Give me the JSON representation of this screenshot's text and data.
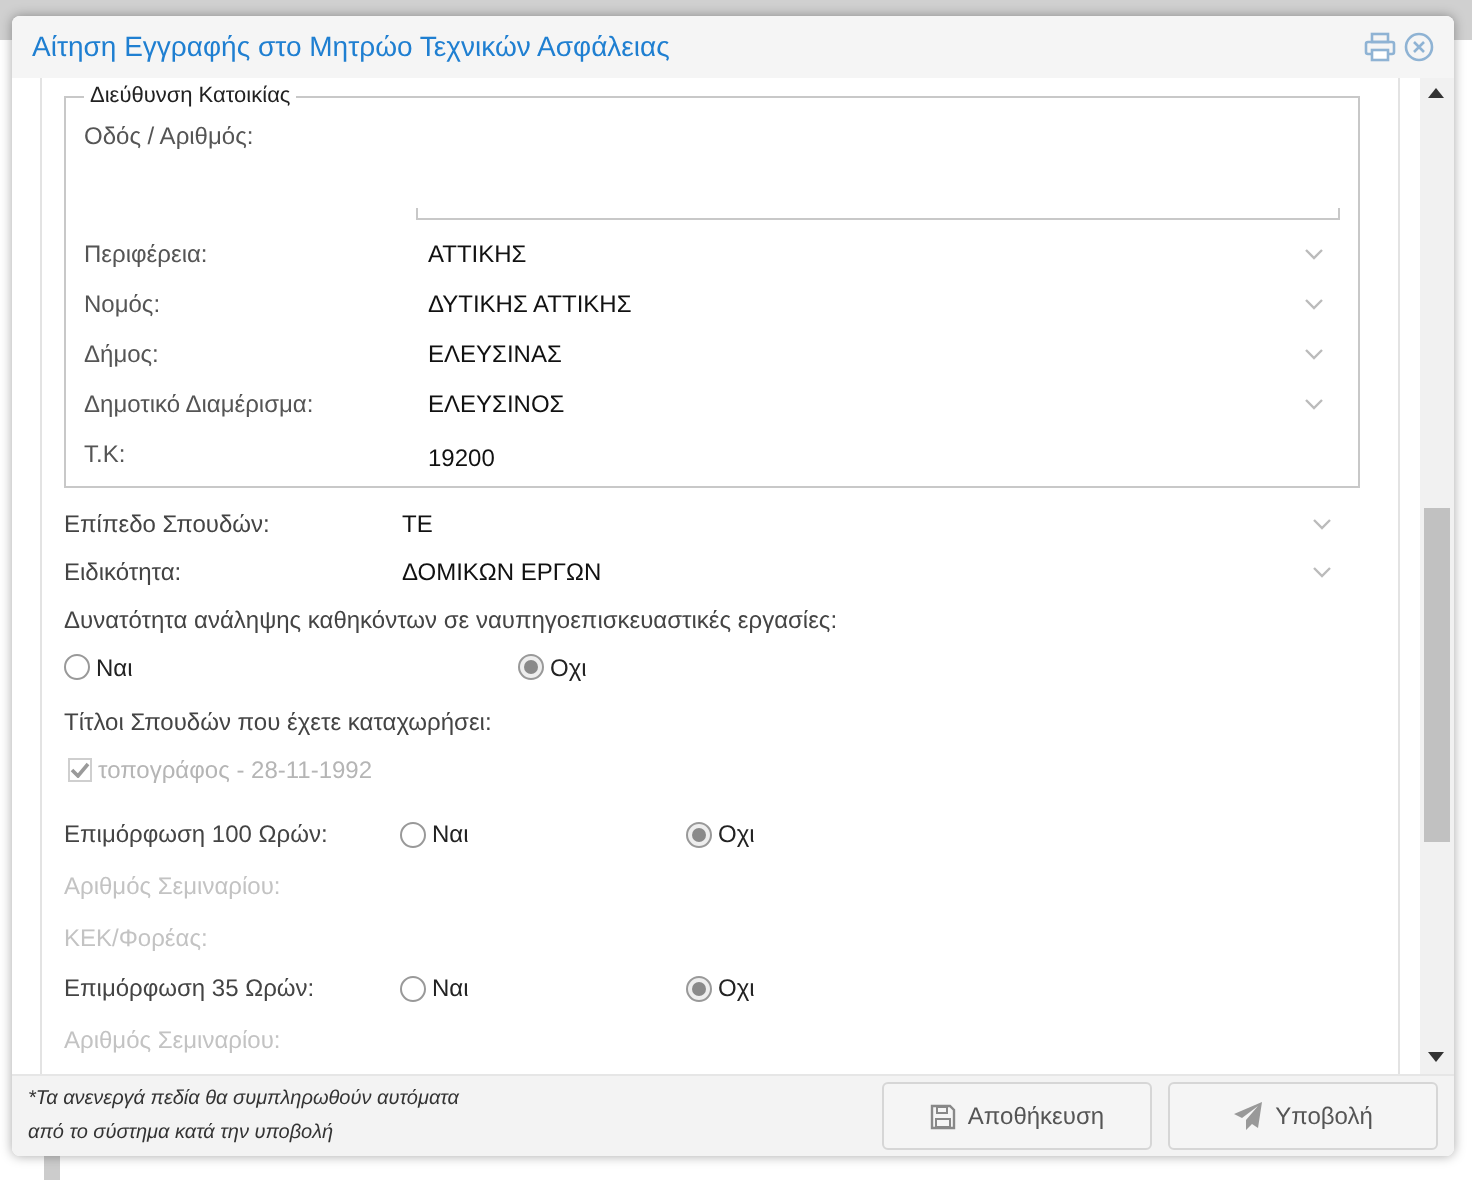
{
  "dialog": {
    "title": "Αίτηση Εγγραφής στο Μητρώο Τεχνικών Ασφάλειας"
  },
  "address": {
    "legend": "Διεύθυνση Κατοικίας",
    "street_label": "Οδός / Αριθμός:",
    "fields": [
      {
        "kind": "select",
        "label": "Περιφέρεια:",
        "value": "ΑΤΤΙΚΗΣ"
      },
      {
        "kind": "select",
        "label": "Νομός:",
        "value": "ΔΥΤΙΚΗΣ ΑΤΤΙΚΗΣ"
      },
      {
        "kind": "select",
        "label": "Δήμος:",
        "value": "ΕΛΕΥΣΙΝΑΣ"
      },
      {
        "kind": "select",
        "label": "Δημοτικό Διαμέρισμα:",
        "value": "ΕΛΕΥΣΙΝΟΣ"
      },
      {
        "kind": "text",
        "label": "Τ.Κ:",
        "value": "19200"
      }
    ]
  },
  "rows": [
    {
      "kind": "select",
      "label": "Επίπεδο Σπουδών:",
      "value": "ΤΕ"
    },
    {
      "kind": "select",
      "label": "Ειδικότητα:",
      "value": "ΔΟΜΙΚΩΝ ΕΡΓΩΝ"
    },
    {
      "kind": "question",
      "label": "Δυνατότητα ανάληψης καθηκόντων σε ναυπηγοεπισκευαστικές εργασίες:"
    },
    {
      "kind": "radios",
      "options": [
        {
          "label": "Ναι",
          "selected": false
        },
        {
          "label": "Οχι",
          "selected": true
        }
      ]
    },
    {
      "kind": "question",
      "label": "Τίτλοι Σπουδών που έχετε καταχωρήσει:"
    },
    {
      "kind": "checkbox",
      "label": "τοπογράφος - 28-11-1992",
      "checked": true,
      "disabled": true
    },
    {
      "kind": "labeled-radios",
      "label": "Επιμόρφωση 100 Ωρών:",
      "options": [
        {
          "label": "Ναι",
          "selected": false
        },
        {
          "label": "Οχι",
          "selected": true
        }
      ]
    },
    {
      "kind": "disabled",
      "label": "Αριθμός Σεμιναρίου:"
    },
    {
      "kind": "disabled",
      "label": "ΚΕΚ/Φορέας:"
    },
    {
      "kind": "labeled-radios",
      "label": "Επιμόρφωση 35 Ωρών:",
      "options": [
        {
          "label": "Ναι",
          "selected": false
        },
        {
          "label": "Οχι",
          "selected": true
        }
      ]
    },
    {
      "kind": "disabled",
      "label": "Αριθμός Σεμιναρίου:"
    }
  ],
  "footer": {
    "note_lines": [
      "*Τα ανενεργά πεδία θα συμπληρωθούν αυτόματα",
      "από το σύστημα κατά την υποβολή"
    ],
    "buttons": [
      {
        "kind": "save",
        "label": "Αποθήκευση"
      },
      {
        "kind": "submit",
        "label": "Υποβολή"
      }
    ]
  }
}
